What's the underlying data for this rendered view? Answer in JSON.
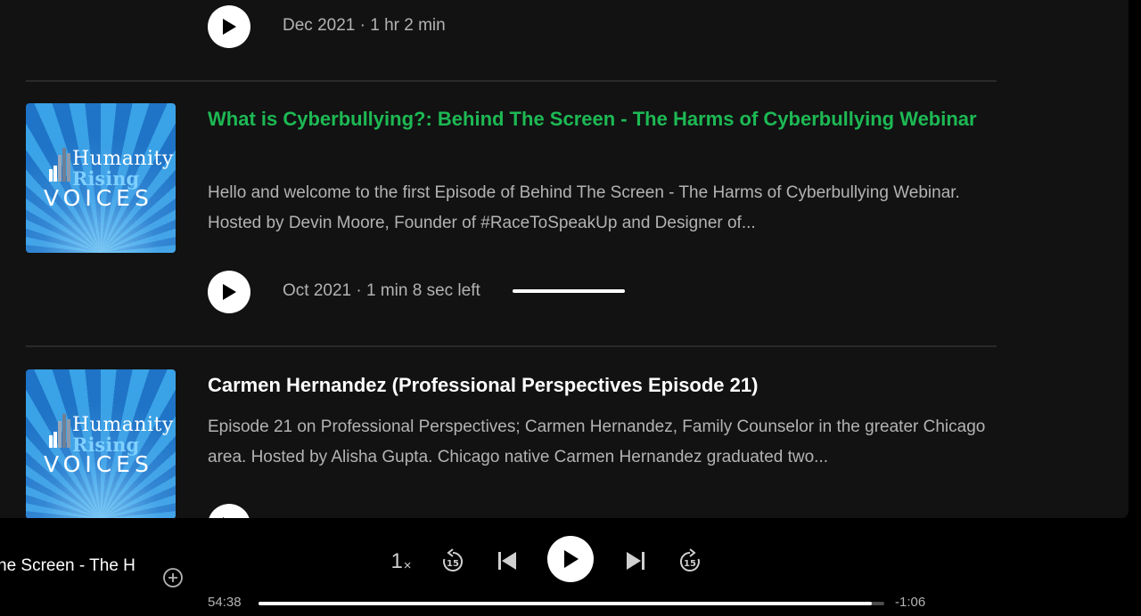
{
  "episodes": [
    {
      "meta": "Dec 2021 · 1 hr 2 min"
    },
    {
      "title": "What is Cyberbullying?: Behind The Screen - The Harms of Cyberbullying Webinar",
      "description": "Hello and welcome to the first Episode of Behind The Screen - The Harms of Cyberbullying Webinar. Hosted by Devin Moore, Founder of #RaceToSpeakUp and Designer of...",
      "meta": "Oct 2021 · 1 min 8 sec left",
      "progress": 0.98,
      "playing": true,
      "artwork": {
        "line1": "Humanity",
        "line2": "Rising",
        "line3": "VOICES"
      }
    },
    {
      "title": "Carmen Hernandez (Professional Perspectives Episode 21)",
      "description": "Episode 21 on Professional Perspectives; Carmen Hernandez, Family Counselor in the greater Chicago area. Hosted by Alisha Gupta.  Chicago native Carmen Hernandez graduated two...",
      "artwork": {
        "line1": "Humanity",
        "line2": "Rising",
        "line3": "VOICES"
      }
    }
  ],
  "player": {
    "now_playing_title": "he Screen - The H",
    "speed_value": "1",
    "speed_unit": "×",
    "skip_back_seconds": "15",
    "skip_forward_seconds": "15",
    "elapsed": "54:38",
    "remaining": "-1:06",
    "progress": 0.98
  },
  "colors": {
    "accent": "#1db954",
    "panel": "#121212",
    "muted_text": "#b3b3b3"
  },
  "icons": {
    "play": "play-icon",
    "add": "plus-circle-icon",
    "previous": "skip-previous-icon",
    "next": "skip-next-icon",
    "rewind": "rewind-15-icon",
    "forward": "forward-15-icon"
  }
}
